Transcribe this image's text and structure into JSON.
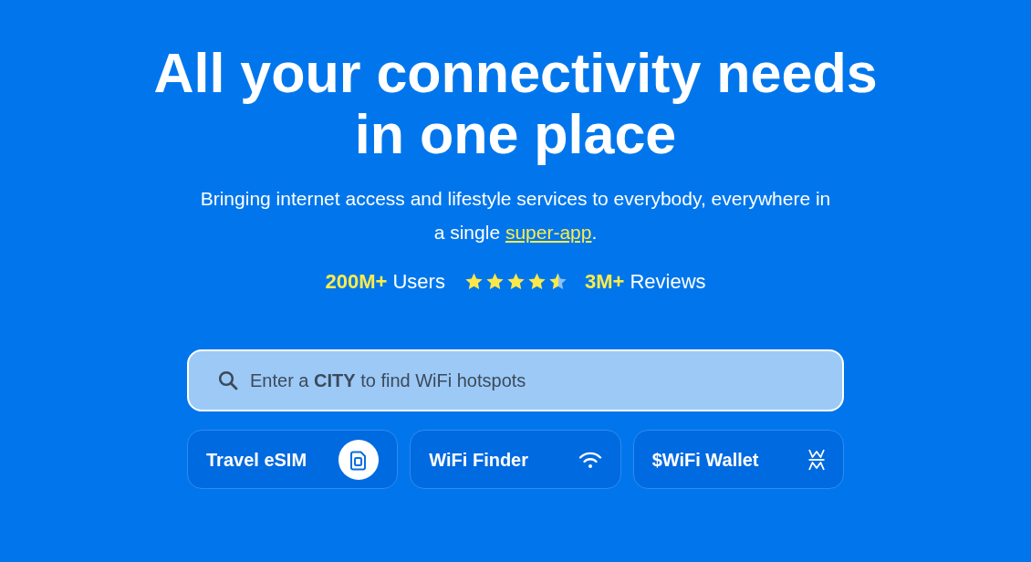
{
  "hero": {
    "headline_lines": [
      "All your connectivity needs",
      "in one place"
    ],
    "subtitle": {
      "line_1": "Bringing internet access and lifestyle services to everybody, everywhere in",
      "line_2_before": "a single ",
      "link": "super-app",
      "line_2_after": "."
    },
    "stats": {
      "users": {
        "value": "200M+",
        "label": "Users"
      },
      "rating": {
        "stars": 4.5
      },
      "reviews": {
        "value": "3M+",
        "label": "Reviews"
      }
    }
  },
  "search": {
    "placeholder": "Enter a **CITY** to find WiFi hotspots"
  },
  "buttons": [
    {
      "label": "Travel eSIM",
      "kind": "sim"
    },
    {
      "label": "WiFi Finder",
      "kind": "wifi"
    },
    {
      "label": "$WiFi Wallet",
      "kind": "wallet"
    }
  ]
}
